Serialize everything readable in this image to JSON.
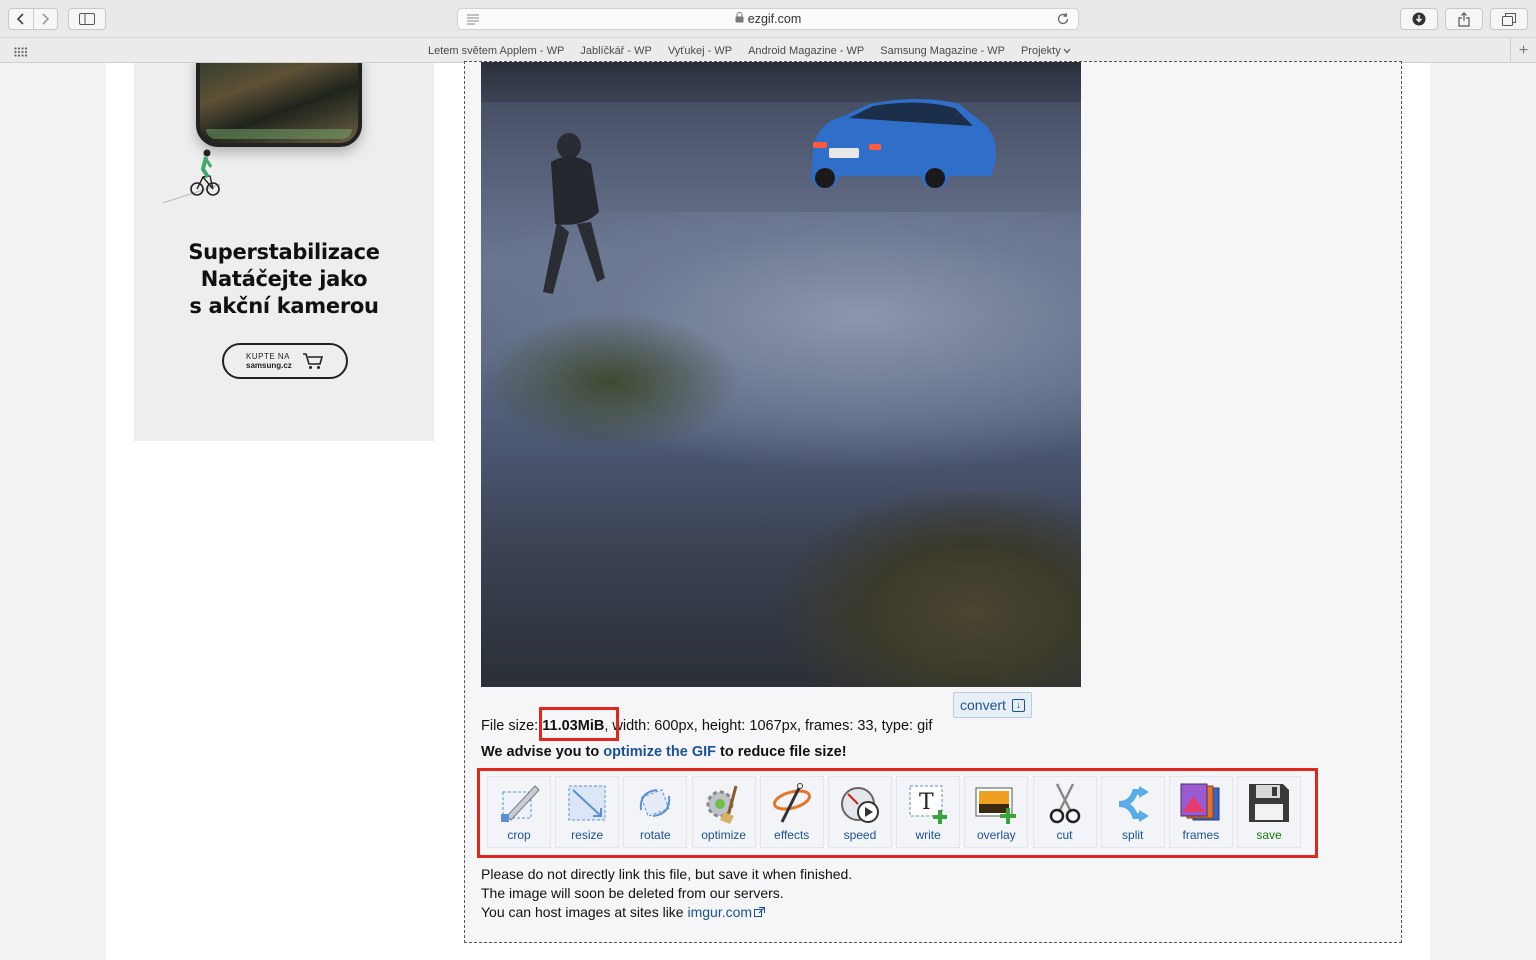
{
  "browser": {
    "url": "ezgif.com",
    "bookmarks": [
      "Letem světem Applem - WP",
      "Jablíčkář - WP",
      "Vyťukej - WP",
      "Android Magazine - WP",
      "Samsung Magazine - WP",
      "Projekty"
    ]
  },
  "ad": {
    "title_line1": "Superstabilizace",
    "title_line2": "Natáčejte jako",
    "title_line3": "s akční kamerou",
    "button_line1": "KUPTE NA",
    "button_line2": "samsung.cz"
  },
  "gif_panel": {
    "convert_label": "convert",
    "file_info_prefix": "File size: ",
    "file_size": "11.03MiB",
    "file_info_rest": ", width: 600px, height: 1067px, frames: 33, type: gif",
    "advise_prefix": "We advise you to ",
    "advise_link": "optimize the GIF",
    "advise_suffix": " to reduce file size!",
    "tools": [
      {
        "label": "crop",
        "icon": "crop-icon"
      },
      {
        "label": "resize",
        "icon": "resize-icon"
      },
      {
        "label": "rotate",
        "icon": "rotate-icon"
      },
      {
        "label": "optimize",
        "icon": "optimize-icon"
      },
      {
        "label": "effects",
        "icon": "effects-icon"
      },
      {
        "label": "speed",
        "icon": "speed-icon"
      },
      {
        "label": "write",
        "icon": "write-icon"
      },
      {
        "label": "overlay",
        "icon": "overlay-icon"
      },
      {
        "label": "cut",
        "icon": "cut-icon"
      },
      {
        "label": "split",
        "icon": "split-icon"
      },
      {
        "label": "frames",
        "icon": "frames-icon"
      },
      {
        "label": "save",
        "icon": "save-icon"
      }
    ],
    "note_line1": "Please do not directly link this file, but save it when finished.",
    "note_line2": "The image will soon be deleted from our servers.",
    "note_line3_prefix": "You can host images at sites like ",
    "note_link": "imgur.com"
  },
  "colors": {
    "link": "#1a5295",
    "highlight": "#e0271c",
    "save_label": "#137a13"
  }
}
